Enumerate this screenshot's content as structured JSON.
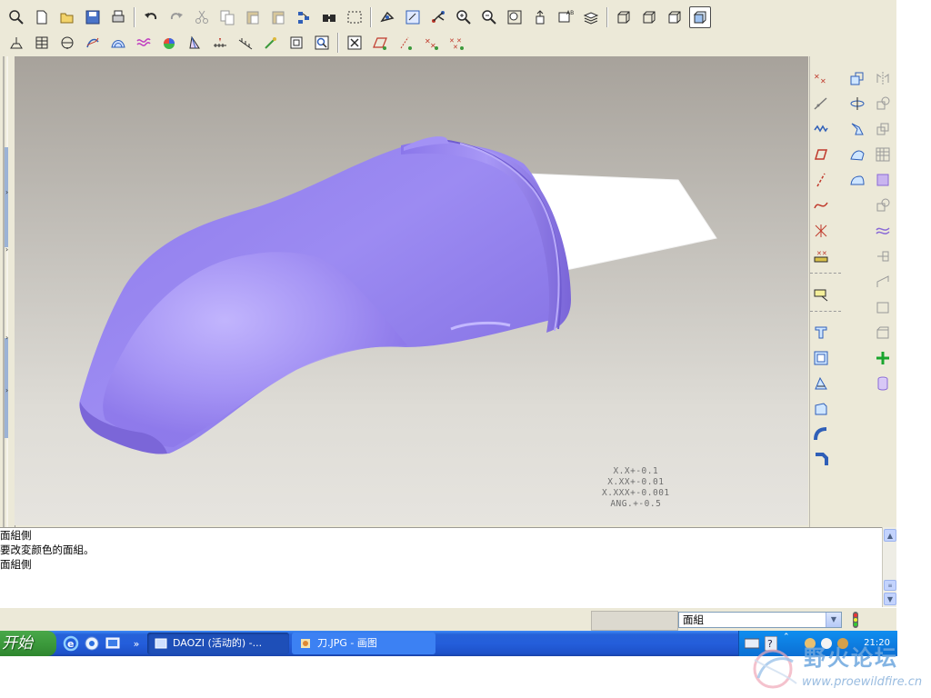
{
  "toolbar": {
    "row1": [
      {
        "name": "search-icon"
      },
      {
        "name": "new-file-icon"
      },
      {
        "name": "open-folder-icon"
      },
      {
        "name": "save-icon"
      },
      {
        "name": "print-icon"
      },
      {
        "sep": true
      },
      {
        "name": "undo-icon"
      },
      {
        "name": "redo-icon"
      },
      {
        "name": "cut-icon"
      },
      {
        "name": "copy-icon"
      },
      {
        "name": "paste-icon"
      },
      {
        "name": "paste-special-icon"
      },
      {
        "name": "regenerate-icon"
      },
      {
        "name": "find-icon"
      },
      {
        "name": "select-box-icon"
      },
      {
        "sep": true
      },
      {
        "name": "repaint-icon"
      },
      {
        "name": "refit-icon"
      },
      {
        "name": "orient-icon"
      },
      {
        "name": "zoom-in-icon"
      },
      {
        "name": "zoom-out-icon"
      },
      {
        "name": "zoom-fit-icon"
      },
      {
        "name": "spin-center-icon"
      },
      {
        "name": "named-view-icon"
      },
      {
        "name": "layers-icon"
      },
      {
        "sep": true
      },
      {
        "name": "wireframe-icon"
      },
      {
        "name": "hidden-line-icon"
      },
      {
        "name": "no-hidden-icon"
      },
      {
        "name": "shading-icon",
        "active": true
      }
    ],
    "row2": [
      {
        "name": "datum-planes-icon"
      },
      {
        "name": "datum-axes-icon"
      },
      {
        "name": "datum-points-icon"
      },
      {
        "name": "coordinate-system-icon"
      },
      {
        "name": "mesh-surface-icon"
      },
      {
        "name": "curve-analysis-icon"
      },
      {
        "name": "shaded-curvature-icon"
      },
      {
        "name": "draft-analysis-icon"
      },
      {
        "name": "measure-icon"
      },
      {
        "name": "section-analysis-icon"
      },
      {
        "name": "datum-curve-icon"
      },
      {
        "name": "sketch-view-icon"
      },
      {
        "name": "model-tree-search-icon"
      },
      {
        "sep": true
      },
      {
        "name": "close-icon"
      },
      {
        "name": "plane-display-icon"
      },
      {
        "name": "axis-display-icon"
      },
      {
        "name": "point-display-icon"
      },
      {
        "name": "csys-display-icon"
      }
    ]
  },
  "right_panel": {
    "col1": [
      "point-tool-icon",
      "spline-tool-icon",
      "wave-curve-icon",
      "plane-tool-icon",
      "axis-tool-icon",
      "curve-tool-icon",
      "csys-tool-icon",
      "ruler-icon",
      "sep",
      "note-tool-icon",
      "sep",
      "extrude-icon",
      "shell-icon",
      "draft-icon",
      "rib-icon",
      "round-icon",
      "chamfer-icon"
    ],
    "col2": [
      "copy-geometry-icon",
      "rotate-icon",
      "warp-icon",
      "blend-surface-icon",
      "boundary-icon",
      "",
      "",
      "",
      "",
      "",
      "",
      "",
      "",
      "",
      "",
      ""
    ],
    "col3": [
      "mirror-icon",
      "move-icon",
      "offset-icon",
      "pattern-icon",
      "fill-icon",
      "trim-icon",
      "merge-icon",
      "extend-icon",
      "thicken-icon",
      "solidify-icon",
      "intersect-icon",
      "add-feature-icon",
      "cylinder-icon"
    ]
  },
  "tolerances": [
    "X.X+-0.1",
    "X.XX+-0.01",
    "X.XXX+-0.001",
    "ANG.+-0.5"
  ],
  "messages": [
    {
      "prefix": "◆",
      "text": "面組側"
    },
    {
      "prefix": "◆",
      "text": "要改変颜色的面組。"
    },
    {
      "prefix": "◆",
      "text": "面組側"
    }
  ],
  "status_bar": {
    "filter_value": "面組"
  },
  "taskbar": {
    "start_label": "开始",
    "tasks": [
      {
        "label": "DAOZI (活动的) -...",
        "active": true
      },
      {
        "label": "刀.JPG - 画图",
        "active": false
      }
    ],
    "clock": "21:20"
  },
  "watermark": {
    "title": "野火论坛",
    "url": "www.proewildfire.cn"
  },
  "colors": {
    "model": "#9a88f0",
    "blade": "#ffffff",
    "taskbar": "#245edb",
    "start": "#3c9a3c"
  }
}
